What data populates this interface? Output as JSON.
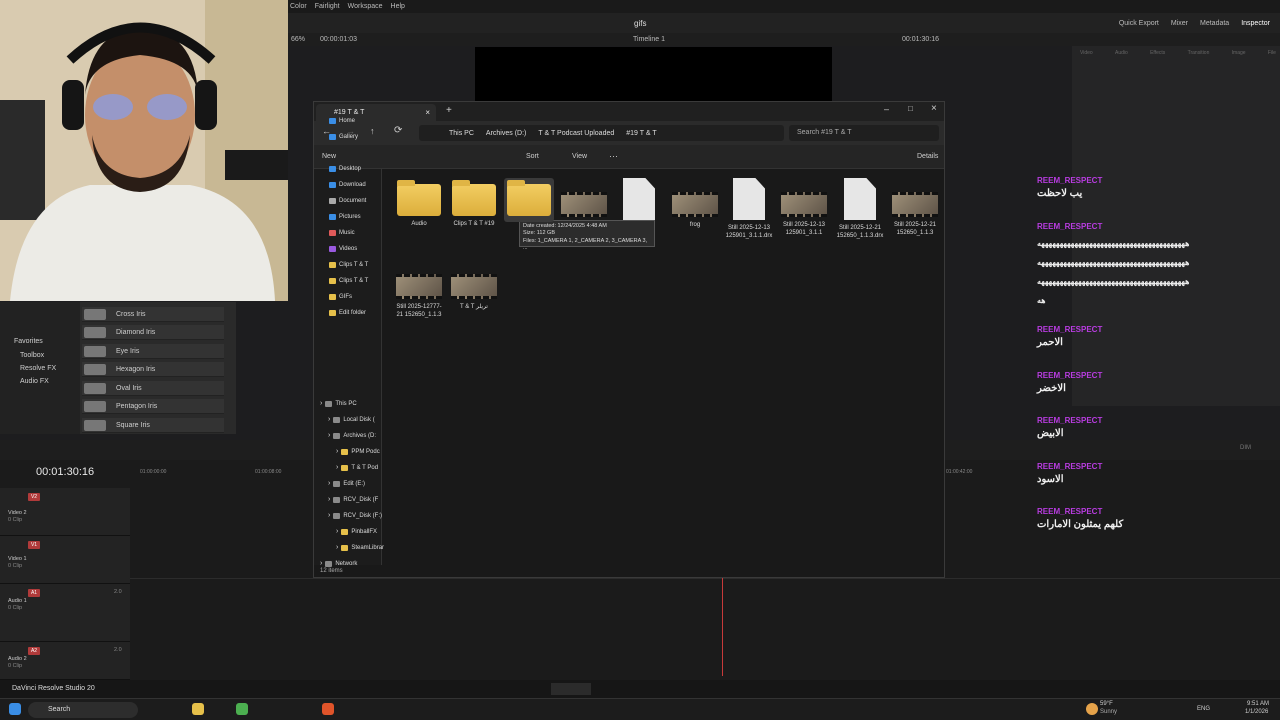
{
  "resolve": {
    "menu": [
      "Color",
      "Fairlight",
      "Workspace",
      "Help"
    ],
    "project_title": "gifs",
    "top_right": [
      "Quick Export",
      "Mixer",
      "Metadata",
      "Inspector"
    ],
    "zoom": "66%",
    "viewer_time": "00:00:01:03",
    "timeline_name": "Timeline 1",
    "viewer_tc": "00:01:30:16",
    "inspector_tabs": [
      "Video",
      "Audio",
      "Effects",
      "Transition",
      "Image",
      "File"
    ],
    "left_panel": [
      "Favorites",
      "Toolbox",
      "Resolve FX",
      "Audio FX"
    ],
    "effects": [
      "Cross Iris",
      "Diamond Iris",
      "Eye Iris",
      "Hexagon Iris",
      "Oval Iris",
      "Pentagon Iris",
      "Square Iris"
    ],
    "timeline_tc": "00:01:30:16",
    "ruler": [
      "01:00:00:00",
      "01:00:08:00",
      "01:00:42:00"
    ],
    "tracks": [
      {
        "badge": "V2",
        "name": "Video 2",
        "clips": "0 Clip"
      },
      {
        "badge": "V1",
        "name": "Video 1",
        "clips": "0 Clip"
      },
      {
        "badge": "A1",
        "name": "Audio 1",
        "clips": "0 Clip",
        "level": "2.0"
      },
      {
        "badge": "A2",
        "name": "Audio 2",
        "clips": "0 Clip",
        "level": "2.0"
      }
    ],
    "app_label": "DaVinci Resolve Studio 20",
    "audio_label": "DIM"
  },
  "explorer": {
    "tab_title": "#19 T & T",
    "breadcrumb": [
      "This PC",
      "Archives (D:)",
      "T & T Podcast Uploaded",
      "#19 T & T"
    ],
    "search_placeholder": "Search #19 T & T",
    "cmd": {
      "new": "New",
      "sort": "Sort",
      "view": "View",
      "details": "Details"
    },
    "nav_quick": [
      {
        "label": "Home",
        "color": "#3a8ee6"
      },
      {
        "label": "Gallery",
        "color": "#3a8ee6"
      },
      {
        "label": "Desktop",
        "color": "#3a8ee6"
      },
      {
        "label": "Download",
        "color": "#3a8ee6"
      },
      {
        "label": "Document",
        "color": "#aaaaaa"
      },
      {
        "label": "Pictures",
        "color": "#3a8ee6"
      },
      {
        "label": "Music",
        "color": "#e05a5a"
      },
      {
        "label": "Videos",
        "color": "#9a5ae0"
      },
      {
        "label": "Clips T & T",
        "color": "#e6c04a"
      },
      {
        "label": "Clips T & T",
        "color": "#e6c04a"
      },
      {
        "label": "GIFs",
        "color": "#e6c04a"
      },
      {
        "label": "Edit folder",
        "color": "#e6c04a"
      }
    ],
    "nav_tree": [
      {
        "label": "This PC",
        "indent": 0
      },
      {
        "label": "Local Disk (",
        "indent": 1
      },
      {
        "label": "Archives (D:",
        "indent": 1
      },
      {
        "label": "PPM Podc",
        "indent": 2
      },
      {
        "label": "T & T Pod",
        "indent": 2
      },
      {
        "label": "Edit (E:)",
        "indent": 1
      },
      {
        "label": "RCV_Disk (F",
        "indent": 1
      },
      {
        "label": "RCV_Disk (F:)",
        "indent": 1
      },
      {
        "label": "PinballFX",
        "indent": 2
      },
      {
        "label": "SteamLibrar",
        "indent": 2
      },
      {
        "label": "Network",
        "indent": 0
      }
    ],
    "files": [
      {
        "name": "Audio",
        "kind": "folder"
      },
      {
        "name": "Clips T & T #19",
        "kind": "folder"
      },
      {
        "name": "",
        "kind": "folder"
      },
      {
        "name": "",
        "kind": "video"
      },
      {
        "name": "",
        "kind": "doc"
      },
      {
        "name": "frog",
        "kind": "video"
      },
      {
        "name": "Still 2025-12-13 125901_3.1.1.drx",
        "kind": "doc"
      },
      {
        "name": "Still 2025-12-13 125901_3.1.1",
        "kind": "video"
      },
      {
        "name": "Still 2025-12-21 152650_1.1.3.drx",
        "kind": "doc"
      },
      {
        "name": "Still 2025-12-21 152650_1.1.3",
        "kind": "video"
      },
      {
        "name": "Still 2025-12777-21 152650_1.1.3",
        "kind": "video"
      },
      {
        "name": "T & T تريلر",
        "kind": "video"
      }
    ],
    "tooltip": [
      "Date created: 12/24/2025 4:48 AM",
      "Size: 112 GB",
      "Files: 1_CAMERA 1, 2_CAMERA 2, 3_CAMERA 3, ..."
    ],
    "status": "12 items"
  },
  "chat": [
    {
      "user": "REEM_RESPECT",
      "text": "يب لاحظت"
    },
    {
      "user": "REEM_RESPECT",
      "text": "ههههههههههههههههههههههههههههههههههههههههه\nههههههههههههههههههههههههههههههههههههههههه\nههههههههههههههههههههههههههههههههههههههههه\nهه"
    },
    {
      "user": "REEM_RESPECT",
      "text": "الاحمر"
    },
    {
      "user": "REEM_RESPECT",
      "text": "الاخضر"
    },
    {
      "user": "REEM_RESPECT",
      "text": "الابيض"
    },
    {
      "user": "REEM_RESPECT",
      "text": "الاسود"
    },
    {
      "user": "REEM_RESPECT",
      "text": "كلهم يمثلون الامارات"
    }
  ],
  "taskbar": {
    "search": "Search",
    "weather_temp": "59°F",
    "weather_desc": "Sunny",
    "lang": "ENG",
    "time": "9:51 AM",
    "date": "1/1/2026"
  }
}
